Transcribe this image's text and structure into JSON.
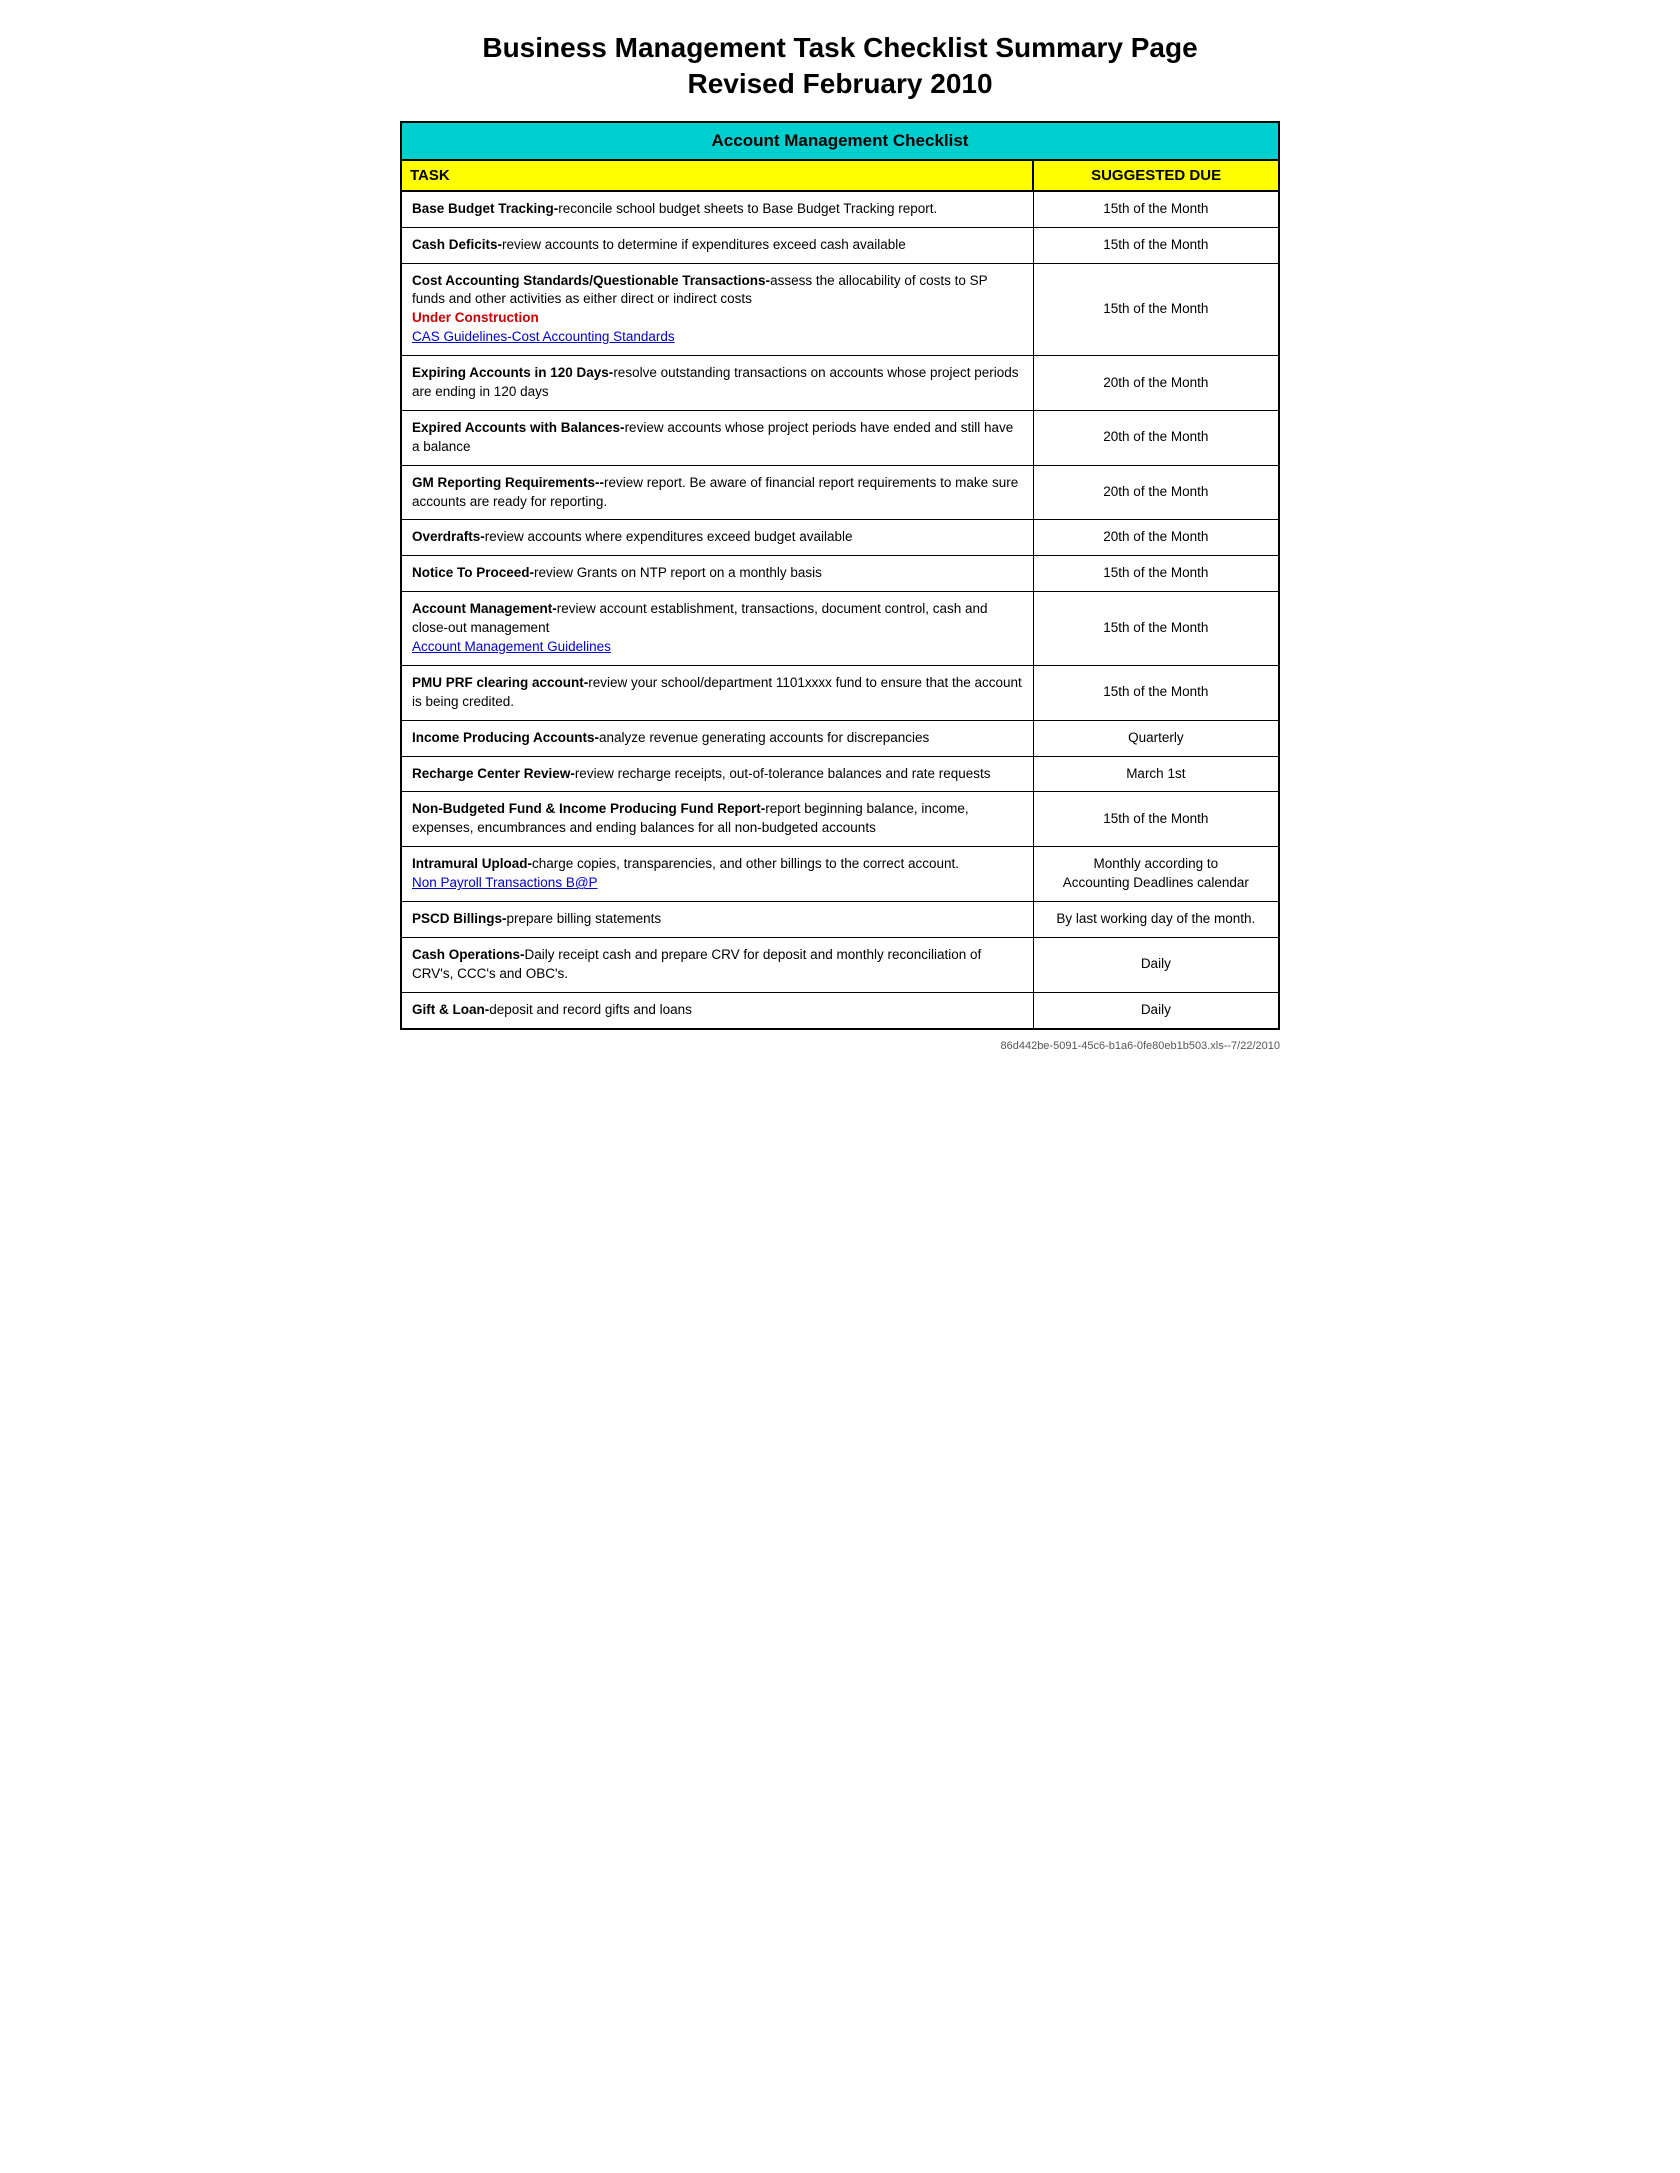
{
  "page": {
    "title_line1": "Business Management Task Checklist Summary Page",
    "title_line2": "Revised February 2010",
    "footer": "86d442be-5091-45c6-b1a6-0fe80eb1b503.xls--7/22/2010"
  },
  "table": {
    "header": "Account Management Checklist",
    "col1_header": "TASK",
    "col2_header": "SUGGESTED DUE",
    "rows": [
      {
        "id": "base-budget-tracking",
        "task_bold": "Base Budget Tracking-",
        "task_rest": "reconcile school budget sheets to Base Budget Tracking report.",
        "due": "15th of the Month",
        "extra": null
      },
      {
        "id": "cash-deficits",
        "task_bold": "Cash Deficits-",
        "task_rest": "review accounts to determine if expenditures exceed cash available",
        "due": "15th of the Month",
        "extra": null
      },
      {
        "id": "cost-accounting",
        "task_bold": "Cost Accounting Standards/Questionable Transactions-",
        "task_rest": "assess the allocability of costs to SP funds and other activities as either direct or indirect costs",
        "due": "15th of the Month",
        "under_construction": "Under Construction",
        "link_text": "CAS Guidelines-Cost Accounting Standards",
        "link_href": "#"
      },
      {
        "id": "expiring-accounts",
        "task_bold": "Expiring Accounts in 120 Days-",
        "task_rest": "resolve outstanding transactions on accounts whose project periods are ending in 120 days",
        "due": "20th of the Month",
        "extra": null
      },
      {
        "id": "expired-accounts",
        "task_bold": "Expired Accounts with Balances-",
        "task_rest": "review accounts whose project periods have ended and still have a balance",
        "due": "20th of the Month",
        "extra": null
      },
      {
        "id": "gm-reporting",
        "task_bold": "GM Reporting Requirements--",
        "task_rest": "review report.  Be aware of financial report requirements to make sure accounts are ready for reporting.",
        "due": "20th of the Month",
        "extra": null
      },
      {
        "id": "overdrafts",
        "task_bold": "Overdrafts-",
        "task_rest": "review accounts where expenditures exceed budget available",
        "due": "20th of the Month",
        "extra": null
      },
      {
        "id": "notice-to-proceed",
        "task_bold": "Notice To Proceed-",
        "task_rest": "review Grants on NTP report on a monthly basis",
        "due": "15th of the Month",
        "extra": null
      },
      {
        "id": "account-management",
        "task_bold": "Account Management-",
        "task_rest": "review account establishment, transactions, document control, cash and close-out management",
        "due": "15th of the Month",
        "link_text": "Account Management Guidelines",
        "link_href": "#"
      },
      {
        "id": "pmu-prf",
        "task_bold": "PMU PRF clearing account-",
        "task_rest": "review your school/department 1101xxxx fund to ensure that the account is being credited.",
        "due": "15th of the Month",
        "extra": null
      },
      {
        "id": "income-producing",
        "task_bold": "Income Producing Accounts-",
        "task_rest": "analyze revenue generating accounts for discrepancies",
        "due": "Quarterly",
        "extra": null
      },
      {
        "id": "recharge-center",
        "task_bold": "Recharge Center Review-",
        "task_rest": "review recharge receipts, out-of-tolerance balances and rate requests",
        "due": "March 1st",
        "extra": null
      },
      {
        "id": "non-budgeted-fund",
        "task_bold": "Non-Budgeted Fund & Income Producing Fund Report-",
        "task_rest": "report beginning balance, income, expenses, encumbrances and ending balances for all non-budgeted accounts",
        "due": "15th of the Month",
        "extra": null
      },
      {
        "id": "intramural-upload",
        "task_bold": "Intramural Upload-",
        "task_rest": "charge copies, transparencies, and other billings to the correct account.",
        "due": "Monthly according to\nAccounting Deadlines calendar",
        "link_text": "Non Payroll Transactions B@P",
        "link_href": "#"
      },
      {
        "id": "pscd-billings",
        "task_bold": "PSCD Billings-",
        "task_rest": "prepare billing statements",
        "due": "By last working day of the month.",
        "extra": null
      },
      {
        "id": "cash-operations",
        "task_bold": "Cash Operations-",
        "task_rest": "Daily receipt cash and prepare CRV for deposit and monthly reconciliation of CRV's, CCC's  and OBC's.",
        "due": "Daily",
        "extra": null
      },
      {
        "id": "gift-loan",
        "task_bold": "Gift & Loan-",
        "task_rest": "deposit and record gifts and loans",
        "due": "Daily",
        "extra": null
      }
    ]
  }
}
